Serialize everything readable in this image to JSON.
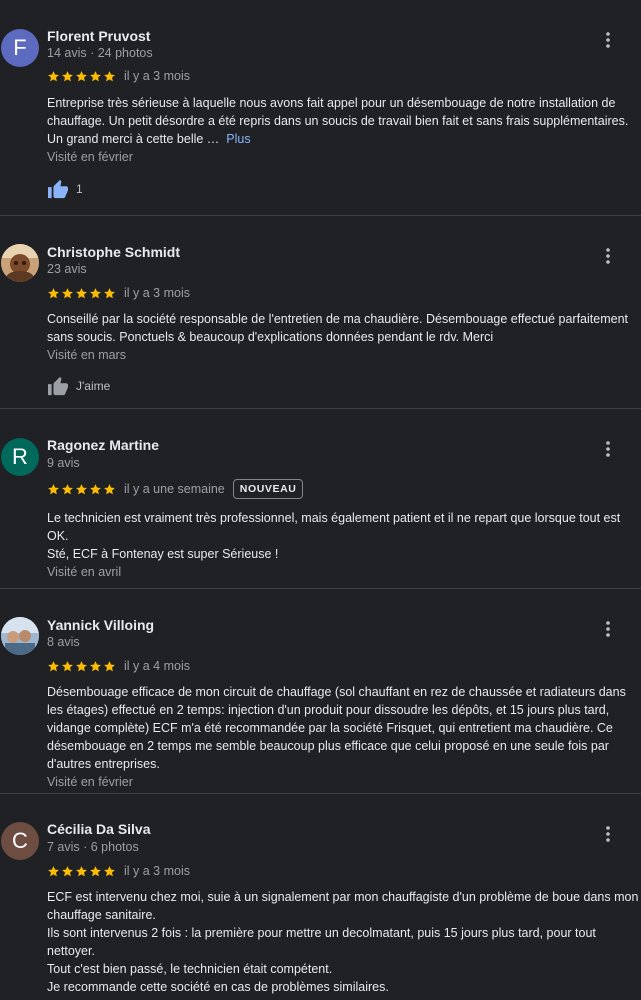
{
  "reviews": [
    {
      "avatar_letter": "F",
      "avatar_color": "#5c6bc0",
      "name": "Florent Pruvost",
      "meta": "14 avis · 24 photos",
      "rating": 5,
      "date": "il y a 3 mois",
      "lines": [
        "Entreprise très sérieuse à laquelle nous avons fait appel pour un désembouage de notre installation de chauffage. Un petit désordre a été repris dans un soucis de travail bien fait et sans frais supplémentaires. Un grand merci à cette belle …"
      ],
      "more_label": "Plus",
      "visited": "Visité en février",
      "like_count": "1"
    },
    {
      "avatar_color": "#8d6e63",
      "name": "Christophe Schmidt",
      "meta": "23 avis",
      "rating": 5,
      "date": "il y a 3 mois",
      "lines": [
        "Conseillé par la société responsable de l'entretien de ma chaudière. Désembouage effectué parfaitement sans soucis. Ponctuels & beaucoup d'explications données pendant le rdv. Merci"
      ],
      "visited": "Visité en mars",
      "like_label": "J'aime"
    },
    {
      "avatar_letter": "R",
      "avatar_color": "#00695c",
      "name": "Ragonez Martine",
      "meta": "9 avis",
      "rating": 5,
      "date": "il y a une semaine",
      "badge": "NOUVEAU",
      "lines": [
        "Le technicien est vraiment très professionnel, mais également patient et il ne repart que lorsque tout est OK.",
        "Sté, ECF à Fontenay est super Sérieuse !"
      ],
      "visited": "Visité en avril"
    },
    {
      "avatar_color": "#6d8aa6",
      "name": "Yannick Villoing",
      "meta": "8 avis",
      "rating": 5,
      "date": "il y a 4 mois",
      "lines": [
        "Désembouage efficace de mon circuit de chauffage (sol chauffant en rez de chaussée et radiateurs dans les étages) effectué en 2 temps: injection d'un produit pour dissoudre les dépôts, et 15 jours plus tard, vidange complète) ECF m'a été recommandée par la société Frisquet, qui entretient ma chaudière. Ce désembouage en 2 temps me semble beaucoup plus efficace que celui proposé en une seule fois par d'autres entreprises."
      ],
      "visited": "Visité en février"
    },
    {
      "avatar_letter": "C",
      "avatar_color": "#6d4c41",
      "name": "Cécilia Da Silva",
      "meta": "7 avis · 6 photos",
      "rating": 5,
      "date": "il y a 3 mois",
      "lines": [
        "ECF est  intervenu chez moi, suie à un signalement par mon chauffagiste d'un problème de boue dans mon chauffage sanitaire.",
        "Ils sont intervenus 2 fois : la première pour mettre un decolmatant, puis 15 jours plus tard, pour tout nettoyer.",
        "Tout c'est bien passé, le technicien était compétent.",
        "Je recommande cette société en cas de problèmes similaires."
      ]
    }
  ],
  "colors": {
    "star": "#fbbc04",
    "link": "#8ab4f8",
    "like_filled": "#8ab4f8",
    "like_empty": "#9aa0a6"
  },
  "icons": {
    "star": "star-icon",
    "more": "more-vert-icon",
    "thumb": "thumb-up-icon"
  }
}
